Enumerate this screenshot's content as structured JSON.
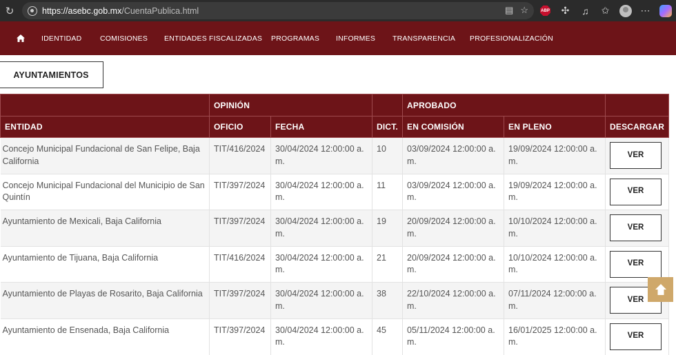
{
  "browser": {
    "url_host": "https://asebc.gob.mx",
    "url_path": "/CuentaPublica.html",
    "abp_label": "ABP"
  },
  "nav": {
    "items": [
      "IDENTIDAD",
      "COMISIONES",
      "ENTIDADES FISCALIZADAS",
      "PROGRAMAS",
      "INFORMES",
      "TRANSPARENCIA",
      "PROFESIONALIZACIÓN"
    ]
  },
  "tab": {
    "label": "AYUNTAMIENTOS"
  },
  "table": {
    "group_headers": {
      "opinion": "OPINIÓN",
      "aprobado": "APROBADO"
    },
    "headers": {
      "entidad": "ENTIDAD",
      "oficio": "OFICIO",
      "fecha": "FECHA",
      "dict": "DICT.",
      "en_comision": "EN COMISIÓN",
      "en_pleno": "EN PLENO",
      "descargar": "DESCARGAR"
    },
    "rows": [
      {
        "entidad": "Concejo Municipal Fundacional de San Felipe, Baja California",
        "oficio": "TIT/416/2024",
        "fecha": "30/04/2024 12:00:00 a. m.",
        "dict": "10",
        "en_comision": "03/09/2024 12:00:00 a. m.",
        "en_pleno": "19/09/2024 12:00:00 a. m.",
        "button": "VER"
      },
      {
        "entidad": "Concejo Municipal Fundacional del Municipio de San Quintín",
        "oficio": "TIT/397/2024",
        "fecha": "30/04/2024 12:00:00 a. m.",
        "dict": "11",
        "en_comision": "03/09/2024 12:00:00 a. m.",
        "en_pleno": "19/09/2024 12:00:00 a. m.",
        "button": "VER"
      },
      {
        "entidad": "Ayuntamiento de Mexicali, Baja California",
        "oficio": "TIT/397/2024",
        "fecha": "30/04/2024 12:00:00 a. m.",
        "dict": "19",
        "en_comision": "20/09/2024 12:00:00 a. m.",
        "en_pleno": "10/10/2024 12:00:00 a. m.",
        "button": "VER"
      },
      {
        "entidad": "Ayuntamiento de Tijuana, Baja California",
        "oficio": "TIT/416/2024",
        "fecha": "30/04/2024 12:00:00 a. m.",
        "dict": "21",
        "en_comision": "20/09/2024 12:00:00 a. m.",
        "en_pleno": "10/10/2024 12:00:00 a. m.",
        "button": "VER"
      },
      {
        "entidad": "Ayuntamiento de Playas de Rosarito, Baja California",
        "oficio": "TIT/397/2024",
        "fecha": "30/04/2024 12:00:00 a. m.",
        "dict": "38",
        "en_comision": "22/10/2024 12:00:00 a. m.",
        "en_pleno": "07/11/2024 12:00:00 a. m.",
        "button": "VER"
      },
      {
        "entidad": "Ayuntamiento de Ensenada, Baja California",
        "oficio": "TIT/397/2024",
        "fecha": "30/04/2024 12:00:00 a. m.",
        "dict": "45",
        "en_comision": "05/11/2024 12:00:00 a. m.",
        "en_pleno": "16/01/2025 12:00:00 a. m.",
        "button": "VER"
      }
    ]
  },
  "colors": {
    "brand": "#6d1418",
    "scroll_button": "#cfa86a"
  }
}
